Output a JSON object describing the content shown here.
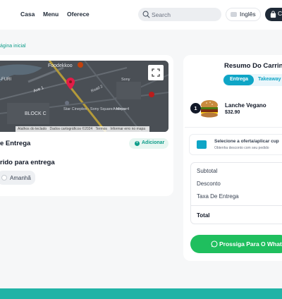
{
  "nav": {
    "home": "Casa",
    "menu": "Menu",
    "offers": "Oferece"
  },
  "search": {
    "placeholder": "Search"
  },
  "language": {
    "label": "Inglês"
  },
  "cart_button": {
    "label": "C"
  },
  "breadcrumb": {
    "label": "ágina inicial"
  },
  "map": {
    "labels": {
      "foodekkoo": "Foodekkoo",
      "furi": "-FURI",
      "avenue": "Ave 1",
      "block": "BLOCK C",
      "complex": "Star Cineplex - Sony Square - Mirpur",
      "sony": "Sony",
      "road": "Road 2",
      "roadstreet": "Avenue 4"
    },
    "footer": [
      "Atalhos do teclado",
      "Dados cartográficos ©2024",
      "Termos",
      "Informar erro no mapa"
    ]
  },
  "delivery": {
    "title": "e Entrega",
    "add_label": "Adicionar",
    "time_title": "rido para entrega",
    "time_option": "Amanhã"
  },
  "cart": {
    "title": "Resumo Do Carrinh",
    "tab_delivery": "Entrega",
    "tab_takeaway": "Takeaway",
    "item": {
      "qty": "1",
      "name": "Lanche Vegano",
      "price": "$32.90"
    },
    "offer_title": "Selecione a oferta/aplicar cup",
    "offer_sub": "Obtenha desconto com seu pedido",
    "summary": {
      "subtotal": "Subtotal",
      "discount": "Desconto",
      "delivery_fee": "Taxa De Entrega",
      "total": "Total"
    },
    "whatsapp_label": "Prossiga Para O Whats"
  },
  "colors": {
    "accent": "#0f9d8a",
    "brand_blue": "#0ea5c6",
    "whatsapp": "#1fbf5e",
    "footer": "#21b3a6"
  }
}
